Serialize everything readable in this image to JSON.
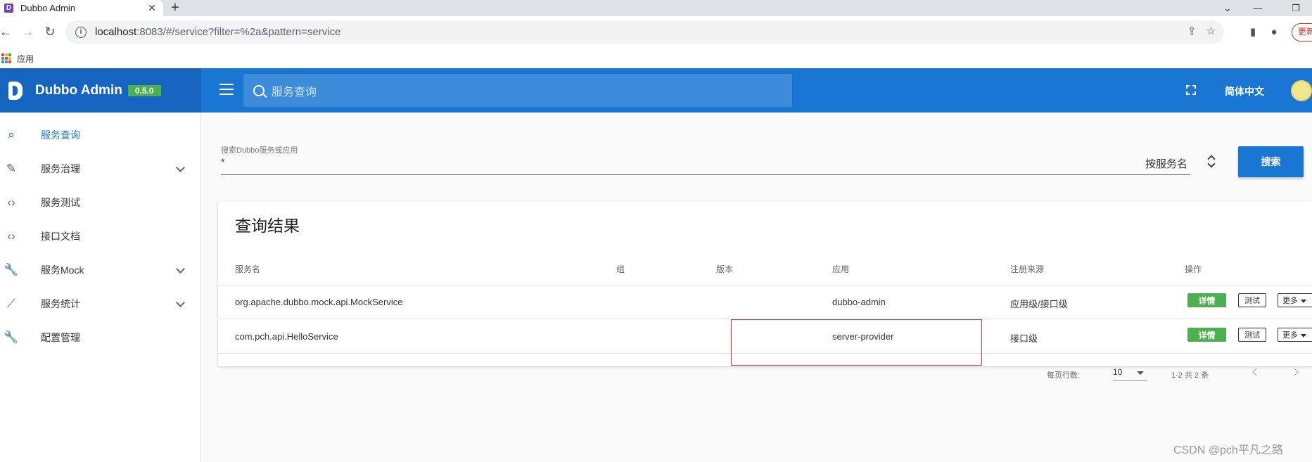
{
  "browser": {
    "tab_title": "Dubbo Admin",
    "tab_favicon": "D",
    "url_host": "localhost",
    "url_rest": ":8083/#/service?filter=%2a&pattern=service",
    "bookmarks_apps_label": "应用",
    "update_label": "更新"
  },
  "header": {
    "brand": "Dubbo Admin",
    "version": "0.5.0",
    "search_placeholder": "服务查询",
    "language": "简体中文"
  },
  "sidebar": {
    "items": [
      {
        "label": "服务查询",
        "icon": "search-icon",
        "active": true
      },
      {
        "label": "服务治理",
        "icon": "pencil-icon",
        "expandable": true
      },
      {
        "label": "服务测试",
        "icon": "code-icon"
      },
      {
        "label": "接口文档",
        "icon": "code-icon"
      },
      {
        "label": "服务Mock",
        "icon": "wrench-icon",
        "expandable": true
      },
      {
        "label": "服务统计",
        "icon": "trending-icon",
        "expandable": true
      },
      {
        "label": "配置管理",
        "icon": "wrench-icon"
      }
    ]
  },
  "search": {
    "label": "搜索Dubbo服务或应用",
    "value": "*",
    "type": "按服务名",
    "button": "搜索"
  },
  "results": {
    "title": "查询结果",
    "columns": [
      "服务名",
      "组",
      "版本",
      "应用",
      "注册来源",
      "操作"
    ],
    "rows": [
      {
        "service": "org.apache.dubbo.mock.api.MockService",
        "group": "",
        "version": "",
        "app": "dubbo-admin",
        "source": "应用级/接口级"
      },
      {
        "service": "com.pch.api.HelloService",
        "group": "",
        "version": "",
        "app": "server-provider",
        "source": "接口级"
      }
    ],
    "actions": {
      "detail": "详情",
      "test": "测试",
      "more": "更多"
    },
    "footer": {
      "rows_per_page_label": "每页行数:",
      "rows_per_page": "10",
      "range": "1-2 共 2 条"
    }
  },
  "watermark": "CSDN @pch平凡之路",
  "colors": {
    "primary": "#1976d2",
    "success": "#4caf50",
    "highlight": "#e53935"
  }
}
